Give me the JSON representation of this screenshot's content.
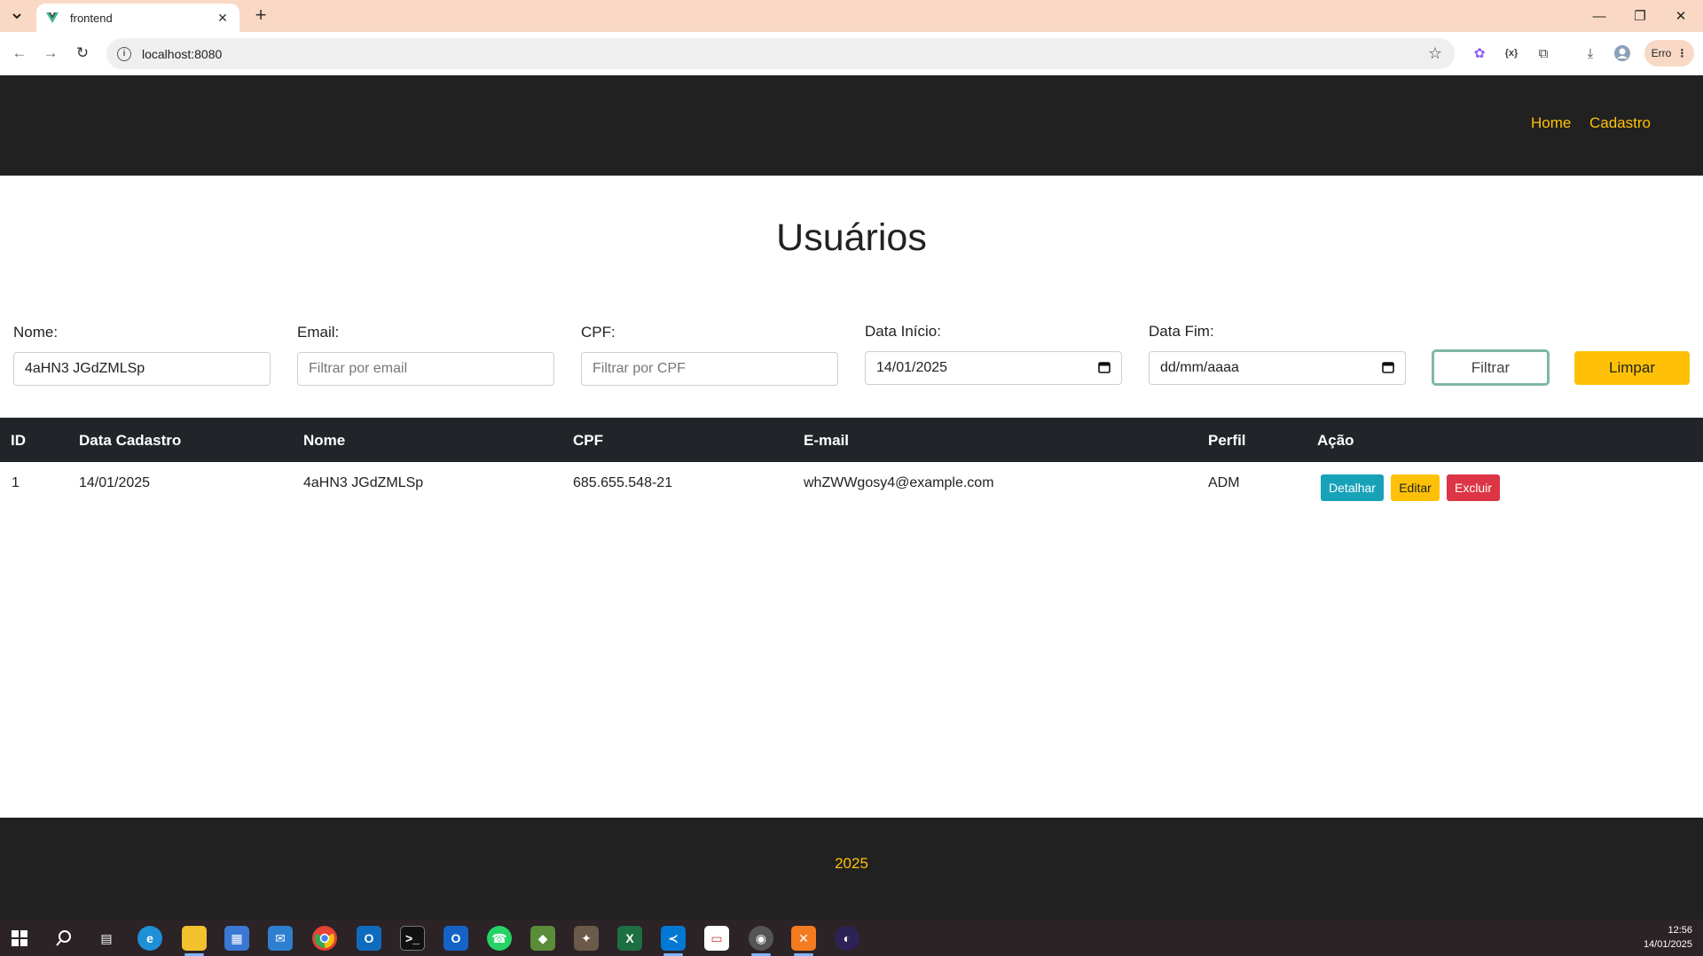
{
  "browser": {
    "tab_title": "frontend",
    "url": "localhost:8080",
    "profile_label": "Erro"
  },
  "header": {
    "nav": [
      {
        "label": "Home"
      },
      {
        "label": "Cadastro"
      }
    ]
  },
  "page": {
    "title": "Usuários"
  },
  "filters": {
    "nome": {
      "label": "Nome:",
      "value": "4aHN3 JGdZMLSp"
    },
    "email": {
      "label": "Email:",
      "placeholder": "Filtrar por email"
    },
    "cpf": {
      "label": "CPF:",
      "placeholder": "Filtrar por CPF"
    },
    "data_inicio": {
      "label": "Data Início:",
      "value": "14/01/2025"
    },
    "data_fim": {
      "label": "Data Fim:",
      "placeholder": "dd/mm/aaaa"
    },
    "filtrar_label": "Filtrar",
    "limpar_label": "Limpar"
  },
  "table": {
    "columns": [
      "ID",
      "Data Cadastro",
      "Nome",
      "CPF",
      "E-mail",
      "Perfil",
      "Ação"
    ],
    "rows": [
      {
        "id": "1",
        "data_cadastro": "14/01/2025",
        "nome": "4aHN3 JGdZMLSp",
        "cpf": "685.655.548-21",
        "email": "whZWWgosy4@example.com",
        "perfil": "ADM",
        "actions": {
          "detalhar": "Detalhar",
          "editar": "Editar",
          "excluir": "Excluir"
        }
      }
    ]
  },
  "footer": {
    "year": "2025"
  },
  "taskbar": {
    "time": "12:56",
    "date": "14/01/2025",
    "icons": [
      "windows-start-icon",
      "search-icon",
      "task-view-icon",
      "edge-icon",
      "file-explorer-icon",
      "store-icon",
      "mail-icon",
      "chrome-icon",
      "outlook-icon",
      "terminal-icon",
      "outlook-new-icon",
      "whatsapp-icon",
      "app-icon",
      "app-icon-2",
      "excel-icon",
      "vscode-icon",
      "pdf-icon",
      "chrome-active-icon",
      "xampp-icon",
      "eclipse-icon"
    ]
  },
  "colors": {
    "accent": "#ffc107",
    "header_bg": "#212121",
    "table_head_bg": "#212529",
    "info": "#17a2b8",
    "danger": "#dc3545",
    "chrome_tab_bg": "#f9d9c5"
  }
}
